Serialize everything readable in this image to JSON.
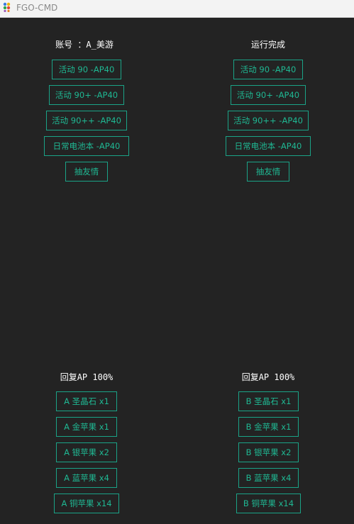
{
  "window": {
    "title": "FGO-CMD"
  },
  "left_panel": {
    "account_label": "账号 ：A_美游",
    "buttons": [
      "活动 90 -AP40",
      "活动 90+ -AP40",
      "活动 90++ -AP40",
      "日常电池本 -AP40",
      "抽友情"
    ]
  },
  "right_panel": {
    "status_label": "运行完成",
    "buttons": [
      "活动 90 -AP40",
      "活动 90+ -AP40",
      "活动 90++ -AP40",
      "日常电池本 -AP40",
      "抽友情"
    ]
  },
  "recover_left": {
    "label": "回复AP 100%",
    "buttons": [
      "A 圣晶石 x1",
      "A 金苹果 x1",
      "A 银苹果 x2",
      "A 蓝苹果 x4",
      "A 铜苹果 x14"
    ]
  },
  "recover_right": {
    "label": "回复AP 100%",
    "buttons": [
      "B 圣晶石 x1",
      "B 金苹果 x1",
      "B 银苹果 x2",
      "B 蓝苹果 x4",
      "B 铜苹果 x14"
    ]
  },
  "colors": {
    "accent": "#1aa387",
    "background": "#232323",
    "titlebar": "#f3f3f3"
  }
}
